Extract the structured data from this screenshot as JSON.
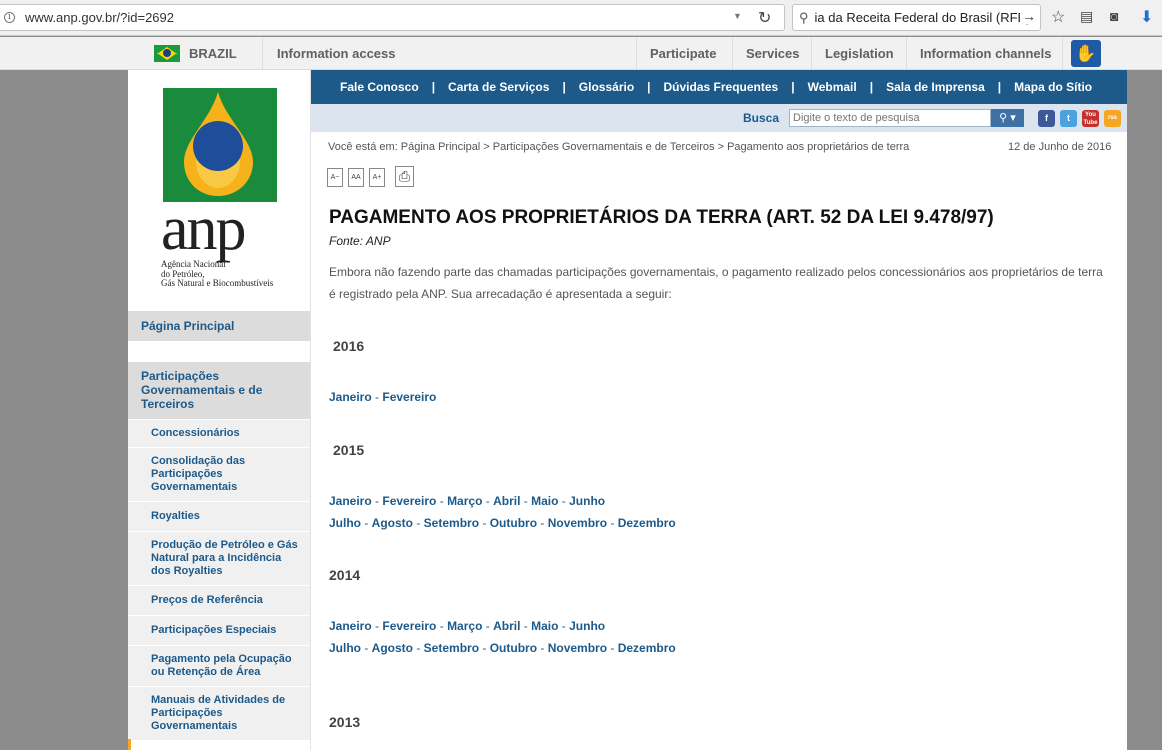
{
  "browser": {
    "url": "www.anp.gov.br/?id=2692",
    "search_value": "ia da Receita Federal do Brasil (RFB).",
    "search_go": "→"
  },
  "govbar": {
    "country": "BRAZIL",
    "items": [
      "Information access",
      "Participate",
      "Services",
      "Legislation",
      "Information channels"
    ]
  },
  "logo": {
    "wordmark": "anp",
    "subtitle_lines": [
      "Agência Nacional",
      "do Petróleo,",
      "Gás Natural e Biocombustíveis"
    ]
  },
  "sidebar": {
    "main_items": [
      "Página Principal",
      "Participações Governamentais e de Terceiros"
    ],
    "sub_items": [
      "Concessionários",
      "Consolidação das Participações Governamentais",
      "Royalties",
      "Produção de Petróleo e Gás Natural para a Incidência dos Royalties",
      "Preços de Referência",
      "Participações Especiais",
      "Pagamento pela Ocupação ou Retenção de Área",
      "Manuais de Atividades de Participações Governamentais"
    ]
  },
  "topnav": {
    "items": [
      "Fale Conosco",
      "Carta de Serviços",
      "Glossário",
      "Dúvidas Frequentes",
      "Webmail",
      "Sala de Imprensa",
      "Mapa do Sítio"
    ],
    "separator": "|"
  },
  "search": {
    "label": "Busca",
    "placeholder": "Digite o texto de pesquisa"
  },
  "social": [
    "f",
    "t",
    "You Tube",
    "rss"
  ],
  "breadcrumb": "Você está em: Página Principal > Participações Governamentais e de Terceiros > Pagamento aos proprietários de terra",
  "date": "12 de Junho de 2016",
  "tools": [
    "A−",
    "AA",
    "A+"
  ],
  "content": {
    "title": "PAGAMENTO AOS PROPRIETÁRIOS DA TERRA (ART. 52 DA LEI 9.478/97)",
    "fonte": "Fonte: ANP",
    "intro": "Embora não fazendo parte das chamadas participações governamentais, o pagamento realizado pelos concessionários aos proprietários de terra é registrado pela ANP. Sua arrecadação é apresentada a seguir:",
    "years": [
      {
        "year": "2016",
        "rows": [
          [
            "Janeiro",
            "Fevereiro"
          ]
        ]
      },
      {
        "year": "2015",
        "rows": [
          [
            "Janeiro",
            "Fevereiro",
            "Março",
            "Abril",
            "Maio",
            "Junho"
          ],
          [
            "Julho",
            "Agosto",
            "Setembro",
            "Outubro",
            "Novembro",
            "Dezembro"
          ]
        ]
      },
      {
        "year": "2014",
        "rows": [
          [
            "Janeiro",
            "Fevereiro",
            "Março",
            "Abril",
            "Maio",
            "Junho"
          ],
          [
            "Julho",
            "Agosto",
            "Setembro",
            "Outubro",
            "Novembro",
            "Dezembro"
          ]
        ]
      },
      {
        "year": "2013",
        "rows": []
      }
    ]
  },
  "colors": {
    "nav_blue": "#1d5a8a",
    "strip": "#dbe4ef",
    "accent_orange": "#f5a623"
  }
}
